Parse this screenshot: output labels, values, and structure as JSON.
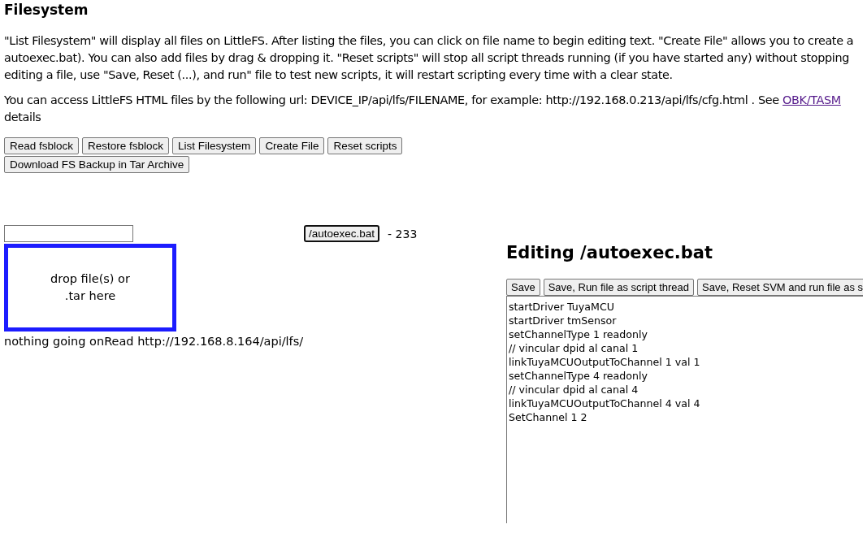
{
  "title": "Filesystem",
  "paragraphs": [
    "\"List Filesystem\" will display all files on LittleFS. After listing the files, you can click on file name to begin editing text. \"Create File\" allows you to create a autoexec.bat). You can also add files by drag & dropping it. \"Reset scripts\" will stop all script threads running (if you have started any) without stopping editing a file, use \"Save, Reset (...), and run\" file to test new scripts, it will restart scripting every time with a clear state.",
    "You can access LittleFS HTML files by the following url: DEVICE_IP/api/lfs/FILENAME, for example: http://192.168.0.213/api/lfs/cfg.html . See "
  ],
  "link": "OBK/TASM",
  "link_after": "details",
  "buttons": [
    "Read fsblock",
    "Restore fsblock",
    "List Filesystem",
    "Create File",
    "Reset scripts",
    "Download FS Backup in Tar Archive"
  ],
  "drop_zone": "drop file(s) or .tar here",
  "status": "nothing going onRead http://192.168.8.164/api/lfs/",
  "files": [
    {
      "name": "/autoexec.bat",
      "size": "- 233",
      "focused": true
    }
  ],
  "editor": {
    "title": "Editing /autoexec.bat",
    "buttons": [
      "Save",
      "Save, Run file as script thread",
      "Save, Reset SVM and run file as s"
    ],
    "lines": [
      "startDriver TuyaMCU",
      "startDriver tmSensor",
      "setChannelType 1 readonly",
      "// vincular dpid al canal 1",
      "linkTuyaMCUOutputToChannel 1 val 1",
      "setChannelType 4 readonly",
      "// vincular dpid al canal 4",
      "linkTuyaMCUOutputToChannel 4 val 4",
      "SetChannel 1 2"
    ]
  }
}
